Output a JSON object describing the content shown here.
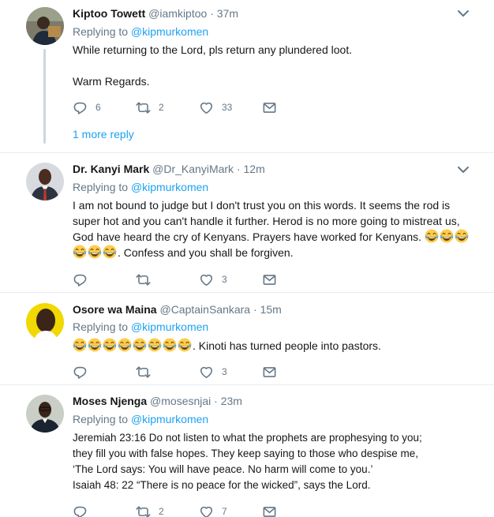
{
  "tweets": [
    {
      "name": "Kiptoo Towett",
      "handle": "@iamkiptoo",
      "time": "37m",
      "replying_label": "Replying to",
      "replying_to": "@kipmurkomen",
      "lines": [
        "While returning to the Lord, pls return any plundered loot.",
        "",
        "Warm Regards."
      ],
      "replies": "6",
      "retweets": "2",
      "likes": "33",
      "more_reply": "1 more reply"
    },
    {
      "name": "Dr. Kanyi Mark",
      "handle": "@Dr_KanyiMark",
      "time": "12m",
      "replying_label": "Replying to",
      "replying_to": "@kipmurkomen",
      "lines": [
        "I am not bound to judge but I don't trust you on this words. It seems the rod is",
        "super hot and you can't handle it further. Herod is no more going to mistreat us,",
        "God have heard the cry of Kenyans. Prayers have worked for Kenyans."
      ],
      "last_line": ". Confess and you shall be forgiven.",
      "replies": "",
      "retweets": "",
      "likes": "3"
    },
    {
      "name": "Osore wa Maina",
      "handle": "@CaptainSankara",
      "time": "15m",
      "replying_label": "Replying to",
      "replying_to": "@kipmurkomen",
      "line": ". Kinoti has turned people into pastors.",
      "replies": "",
      "retweets": "",
      "likes": "3"
    },
    {
      "name": "Moses Njenga",
      "handle": "@mosesnjai",
      "time": "23m",
      "replying_label": "Replying to",
      "replying_to": "@kipmurkomen",
      "lines": [
        "Jeremiah 23:16 Do not listen to what the prophets are prophesying to you;",
        "they fill you with false hopes. They keep saying to those who despise me,",
        "‘The Lord says: You will have peace. No harm will come to you.’",
        "Isaiah 48: 22 “There is no peace for the wicked”, says the Lord."
      ],
      "replies": "",
      "retweets": "2",
      "likes": "7"
    }
  ],
  "emoji_name": "face-with-tears-of-joy",
  "colors": {
    "link": "#1da1f2",
    "secondary": "#657786",
    "border": "#e6ecf0",
    "thread_line": "#ccd6dd"
  }
}
